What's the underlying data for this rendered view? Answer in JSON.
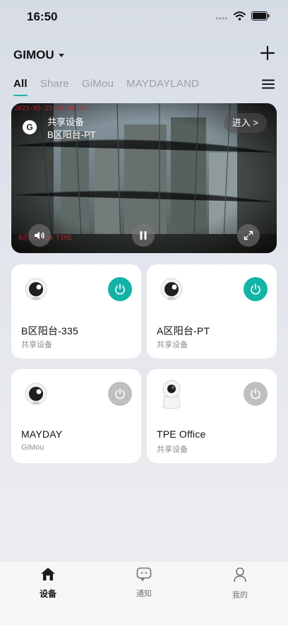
{
  "status_bar": {
    "time": "16:50"
  },
  "header": {
    "account_name": "GIMOU"
  },
  "tabs": [
    "All",
    "Share",
    "GiMou",
    "MAYDAYLAND"
  ],
  "active_tab": "All",
  "live_view": {
    "badge": "共享设备",
    "name": "B区阳台-PT",
    "enter_label": "进入 >",
    "timestamp_top": "2023-05-25 16:50:49",
    "timestamp_bottom": "B区阳台 ON FIRE"
  },
  "devices": [
    {
      "name": "B区阳台-335",
      "subtitle": "共享设备",
      "power": "on",
      "icon": "round-camera-icon"
    },
    {
      "name": "A区阳台-PT",
      "subtitle": "共享设备",
      "power": "on",
      "icon": "round-camera-icon"
    },
    {
      "name": "MAYDAY",
      "subtitle": "GiMou",
      "power": "off",
      "icon": "round-camera-icon"
    },
    {
      "name": "TPE Office",
      "subtitle": "共享设备",
      "power": "off",
      "icon": "dome-camera-icon"
    }
  ],
  "tab_bar": {
    "items": [
      {
        "label": "设备",
        "icon": "home-icon"
      },
      {
        "label": "通知",
        "icon": "message-icon"
      },
      {
        "label": "我的",
        "icon": "person-icon"
      }
    ],
    "active": "设备"
  },
  "colors": {
    "accent": "#14b3a8",
    "power_off": "#bfbfbf"
  }
}
